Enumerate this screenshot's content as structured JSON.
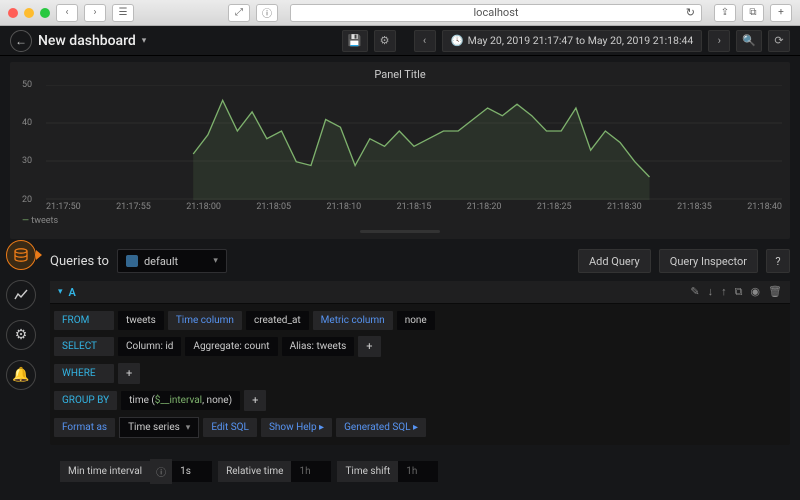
{
  "browser": {
    "url": "localhost"
  },
  "toolbar": {
    "title": "New dashboard",
    "time_range": "May 20, 2019 21:17:47 to May 20, 2019 21:18:44"
  },
  "panel": {
    "title": "Panel Title",
    "legend_series": "tweets"
  },
  "chart_data": {
    "type": "line",
    "title": "Panel Title",
    "xlabel": "",
    "ylabel": "",
    "ylim": [
      20,
      50
    ],
    "y_ticks": [
      20,
      30,
      40,
      50
    ],
    "categories": [
      "21:17:50",
      "21:17:55",
      "21:18:00",
      "21:18:05",
      "21:18:10",
      "21:18:15",
      "21:18:20",
      "21:18:25",
      "21:18:30",
      "21:18:35",
      "21:18:40"
    ],
    "series": [
      {
        "name": "tweets",
        "color": "#7eb26d",
        "x_start_index": 2,
        "values": [
          32,
          37,
          46,
          38,
          43,
          36,
          38,
          30,
          29,
          41,
          39,
          29,
          36,
          34,
          38,
          34,
          36,
          38,
          38,
          41,
          44,
          42,
          45,
          42,
          38,
          38,
          44,
          33,
          38,
          35,
          30,
          26
        ]
      }
    ]
  },
  "editor": {
    "head": "Queries to",
    "datasource": "default",
    "add_query": "Add Query",
    "inspector": "Query Inspector",
    "letter": "A",
    "from": {
      "kw": "FROM",
      "table": "tweets",
      "time_col_label": "Time column",
      "time_col": "created_at",
      "metric_label": "Metric column",
      "metric": "none"
    },
    "select": {
      "kw": "SELECT",
      "col": "Column: id",
      "agg": "Aggregate: count",
      "alias": "Alias: tweets"
    },
    "where": {
      "kw": "WHERE"
    },
    "group": {
      "kw": "GROUP BY",
      "time_fn": "time (",
      "interval": "$__interval",
      "tail": ", none)"
    },
    "format": {
      "kw": "Format as",
      "value": "Time series",
      "edit": "Edit SQL",
      "help": "Show Help",
      "gen": "Generated SQL"
    }
  },
  "opts": {
    "min_interval_label": "Min time interval",
    "min_interval_value": "1s",
    "relative_label": "Relative time",
    "relative_value": "1h",
    "shift_label": "Time shift",
    "shift_value": "1h"
  }
}
